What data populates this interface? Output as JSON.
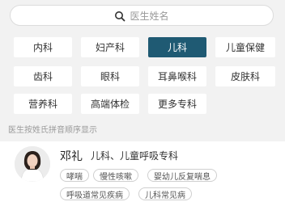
{
  "search": {
    "placeholder": "医生姓名"
  },
  "departments": [
    {
      "label": "内科",
      "active": false
    },
    {
      "label": "妇产科",
      "active": false
    },
    {
      "label": "儿科",
      "active": true
    },
    {
      "label": "儿童保健",
      "active": false
    },
    {
      "label": "齿科",
      "active": false
    },
    {
      "label": "眼科",
      "active": false
    },
    {
      "label": "耳鼻喉科",
      "active": false
    },
    {
      "label": "皮肤科",
      "active": false
    },
    {
      "label": "营养科",
      "active": false
    },
    {
      "label": "高端体检",
      "active": false
    },
    {
      "label": "更多专科",
      "active": false
    }
  ],
  "list_hint": "医生按姓氏拼音顺序显示",
  "doctor": {
    "name": "邓礼",
    "departments": "儿科、儿童呼吸专科",
    "tags": [
      "哮喘",
      "慢性咳嗽",
      "婴幼儿反复喘息",
      "呼吸道常见疾病",
      "儿科常见病"
    ]
  },
  "colors": {
    "active_chip": "#1f5a73",
    "panel_bg": "#f2f2f2"
  }
}
